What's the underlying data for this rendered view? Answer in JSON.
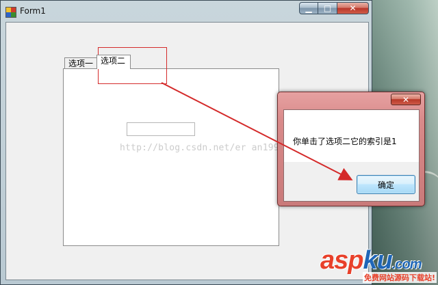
{
  "window": {
    "title": "Form1",
    "minimize": "▁",
    "maximize": "□",
    "close": "✕"
  },
  "tabs": [
    {
      "label": "选项一"
    },
    {
      "label": "选项二",
      "selected": true
    }
  ],
  "textbox": {
    "value": ""
  },
  "watermark": "http://blog.csdn.net/er   an1992",
  "message_box": {
    "close": "✕",
    "text": "你单击了选项二它的索引是1",
    "ok_label": "确定"
  },
  "logo": {
    "asp": "asp",
    "ku": "ku",
    "dotcom": ".com",
    "tagline": "免费网站源码下载站!"
  },
  "colors": {
    "highlight": "#d42a2a",
    "logo_red": "#e8402a",
    "logo_blue": "#1f66b7"
  }
}
